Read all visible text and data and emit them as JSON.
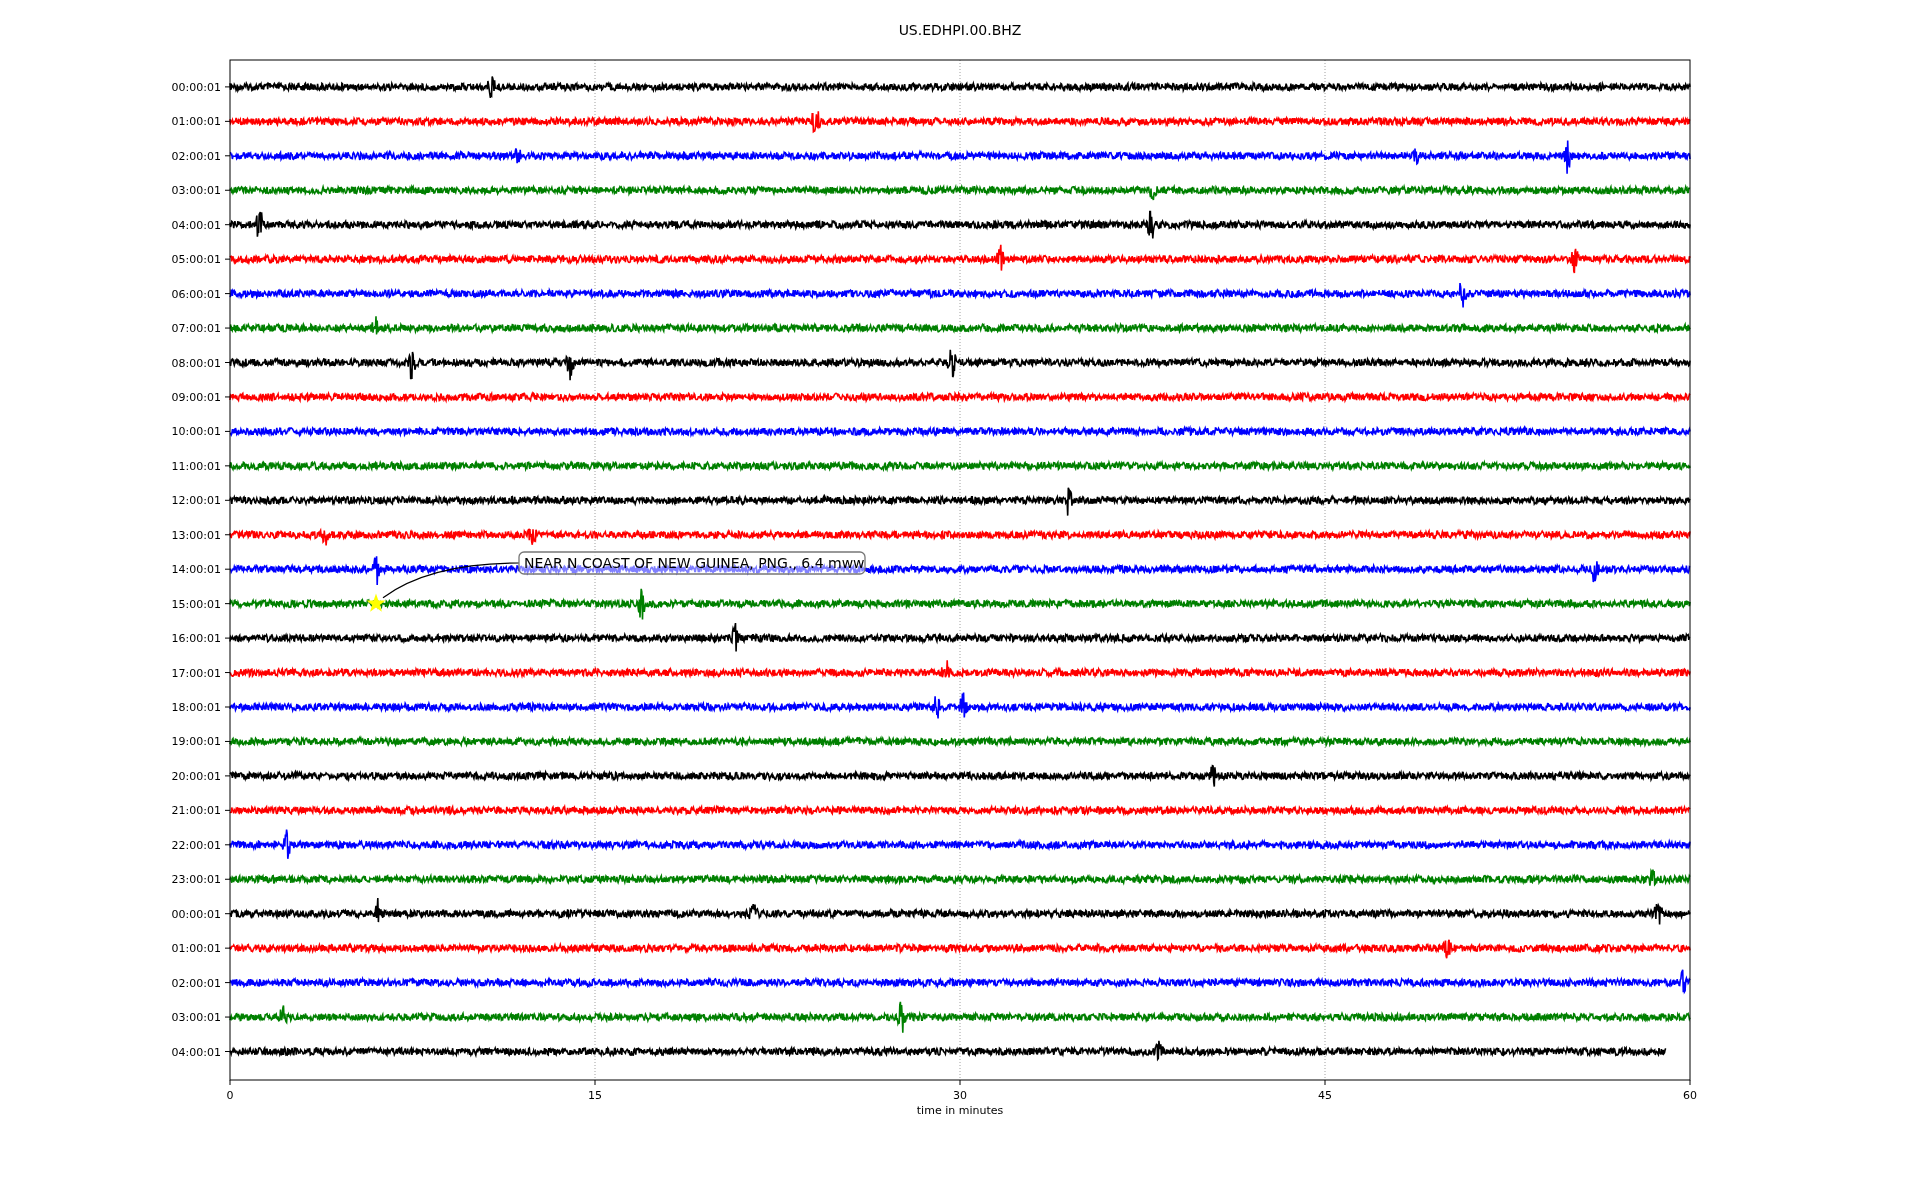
{
  "title": "US.EDHPI.00.BHZ",
  "rows": [
    {
      "label": "00:00:01",
      "color": "#000000"
    },
    {
      "label": "01:00:01",
      "color": "#ff0000"
    },
    {
      "label": "02:00:01",
      "color": "#0000ff"
    },
    {
      "label": "03:00:01",
      "color": "#008000"
    },
    {
      "label": "04:00:01",
      "color": "#000000"
    },
    {
      "label": "05:00:01",
      "color": "#ff0000"
    },
    {
      "label": "06:00:01",
      "color": "#0000ff"
    },
    {
      "label": "07:00:01",
      "color": "#008000"
    },
    {
      "label": "08:00:01",
      "color": "#000000"
    },
    {
      "label": "09:00:01",
      "color": "#ff0000"
    },
    {
      "label": "10:00:01",
      "color": "#0000ff"
    },
    {
      "label": "11:00:01",
      "color": "#008000"
    },
    {
      "label": "12:00:01",
      "color": "#000000"
    },
    {
      "label": "13:00:01",
      "color": "#ff0000"
    },
    {
      "label": "14:00:01",
      "color": "#0000ff"
    },
    {
      "label": "15:00:01",
      "color": "#008000"
    },
    {
      "label": "16:00:01",
      "color": "#000000"
    },
    {
      "label": "17:00:01",
      "color": "#ff0000"
    },
    {
      "label": "18:00:01",
      "color": "#0000ff"
    },
    {
      "label": "19:00:01",
      "color": "#008000"
    },
    {
      "label": "20:00:01",
      "color": "#000000"
    },
    {
      "label": "21:00:01",
      "color": "#ff0000"
    },
    {
      "label": "22:00:01",
      "color": "#0000ff"
    },
    {
      "label": "23:00:01",
      "color": "#008000"
    },
    {
      "label": "00:00:01",
      "color": "#000000"
    },
    {
      "label": "01:00:01",
      "color": "#ff0000"
    },
    {
      "label": "02:00:01",
      "color": "#0000ff"
    },
    {
      "label": "03:00:01",
      "color": "#008000"
    },
    {
      "label": "04:00:01",
      "color": "#000000"
    }
  ],
  "xticks": [
    "0",
    "15",
    "30",
    "45",
    "60"
  ],
  "xlabel": "time in minutes",
  "annotation": {
    "text": "NEAR N COAST OF NEW GUINEA, PNG., 6.4 mww"
  }
}
